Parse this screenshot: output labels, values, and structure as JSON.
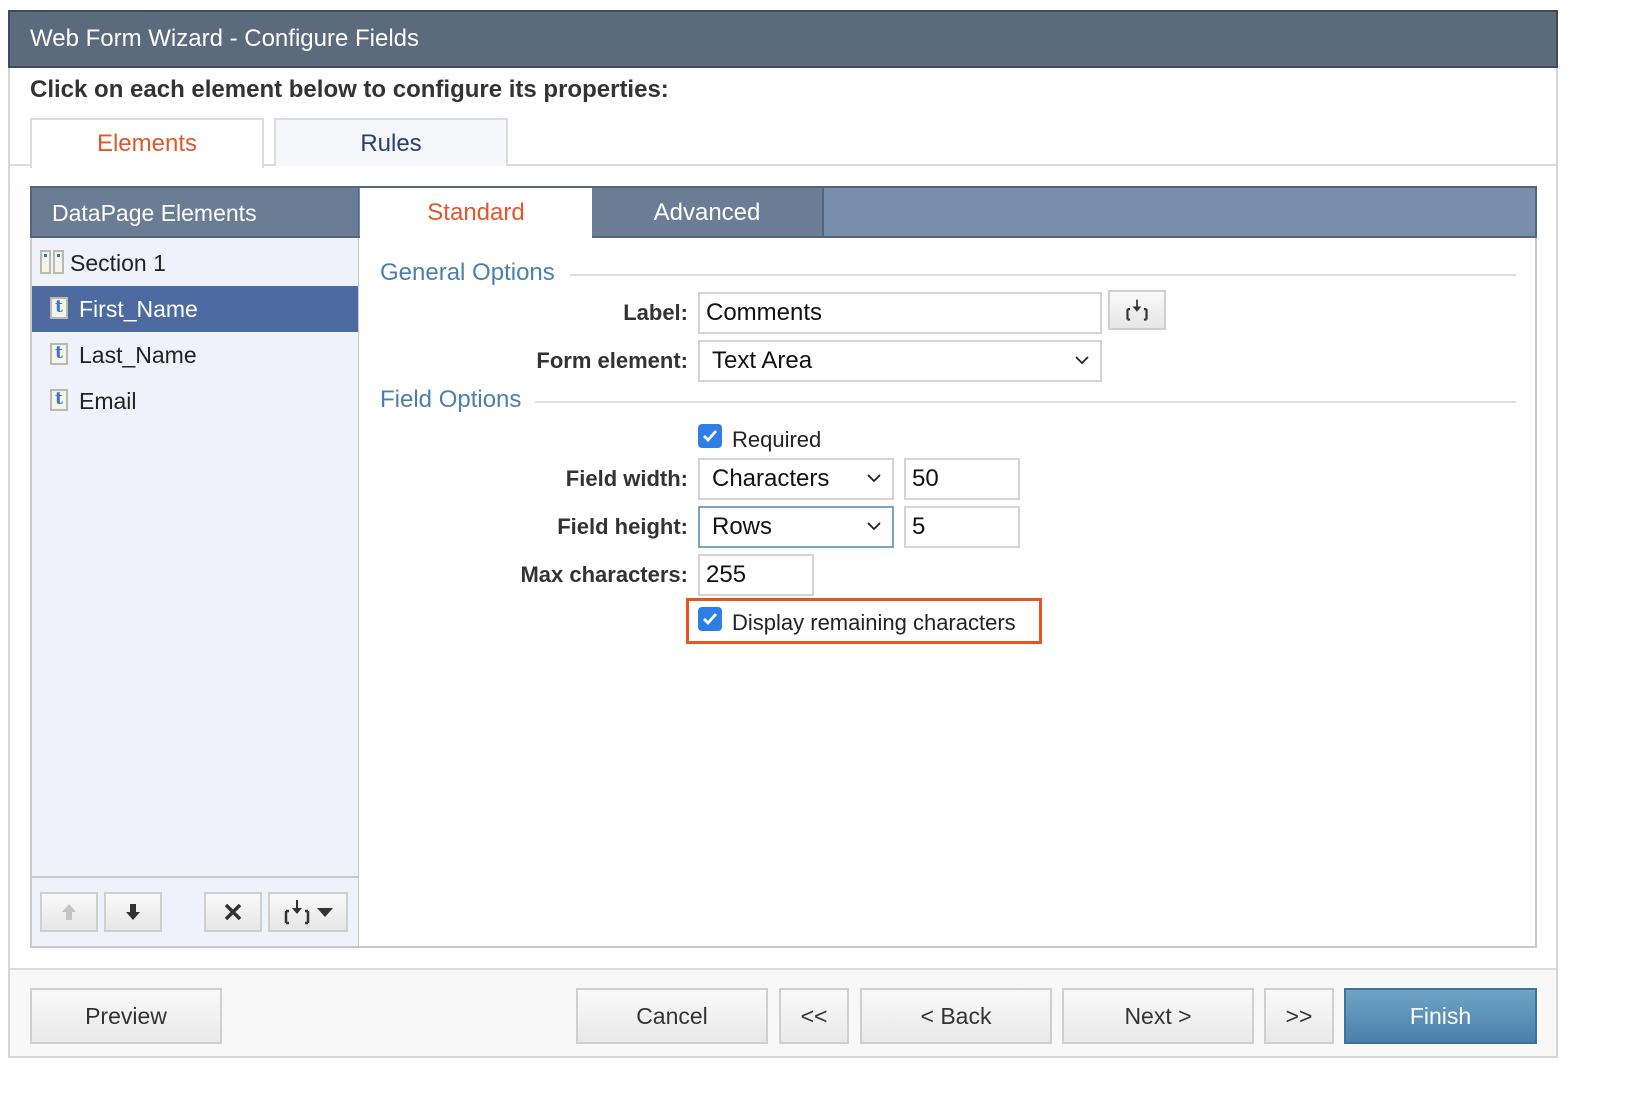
{
  "window": {
    "title": "Web Form Wizard - Configure Fields"
  },
  "instruction": "Click on each element below to configure its properties:",
  "top_tabs": [
    {
      "label": "Elements",
      "active": true
    },
    {
      "label": "Rules",
      "active": false
    }
  ],
  "left_panel": {
    "header": "DataPage Elements",
    "items": [
      {
        "label": "Section 1",
        "icon": "section-icon",
        "selected": false
      },
      {
        "label": "First_Name",
        "icon": "text-field-icon",
        "selected": true
      },
      {
        "label": "Last_Name",
        "icon": "text-field-icon",
        "selected": false
      },
      {
        "label": "Email",
        "icon": "text-field-icon",
        "selected": false
      }
    ],
    "toolbar": [
      "move-up-icon",
      "move-down-icon",
      "delete-icon",
      "insert-icon"
    ]
  },
  "sub_tabs": [
    {
      "label": "Standard",
      "active": true
    },
    {
      "label": "Advanced",
      "active": false
    }
  ],
  "general_options": {
    "legend": "General Options",
    "label_field": {
      "label": "Label:",
      "value": "Comments"
    },
    "form_element": {
      "label": "Form element:",
      "value": "Text Area"
    }
  },
  "field_options": {
    "legend": "Field Options",
    "required": {
      "label": "Required",
      "checked": true
    },
    "field_width": {
      "label": "Field width:",
      "unit": "Characters",
      "value": "50"
    },
    "field_height": {
      "label": "Field height:",
      "unit": "Rows",
      "value": "5"
    },
    "max_characters": {
      "label": "Max characters:",
      "value": "255"
    },
    "display_remaining": {
      "label": "Display remaining characters",
      "checked": true
    }
  },
  "footer": {
    "preview": "Preview",
    "cancel": "Cancel",
    "first": "<<",
    "back": "< Back",
    "next": "Next >",
    "last": ">>",
    "finish": "Finish"
  },
  "colors": {
    "accent_orange": "#e0572a",
    "highlight": "#e8551f",
    "title_bar": "#5b6a7c",
    "selected_row": "#4d6ba0",
    "finish": "#4b80aa",
    "checkbox": "#2f7ee6"
  }
}
